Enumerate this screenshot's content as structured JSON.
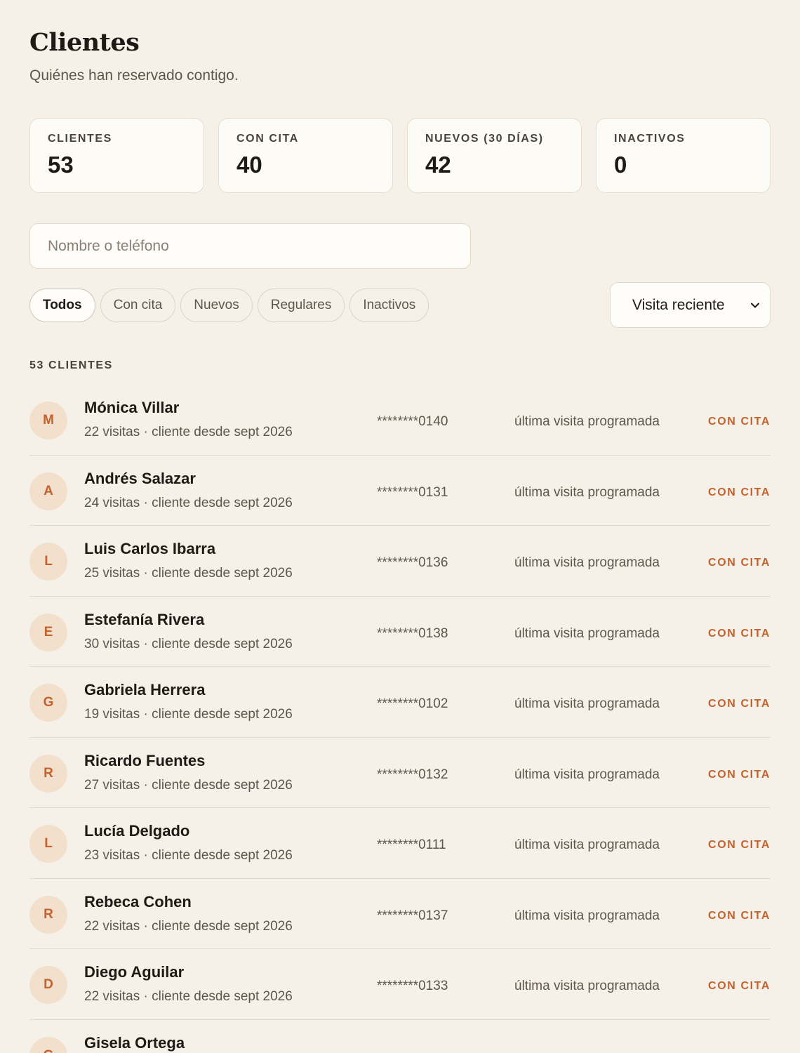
{
  "header": {
    "title": "Clientes",
    "subtitle": "Quiénes han reservado contigo."
  },
  "stats": [
    {
      "label": "CLIENTES",
      "value": "53"
    },
    {
      "label": "CON CITA",
      "value": "40"
    },
    {
      "label": "NUEVOS (30 DÍAS)",
      "value": "42"
    },
    {
      "label": "INACTIVOS",
      "value": "0"
    }
  ],
  "search": {
    "placeholder": "Nombre o teléfono",
    "value": ""
  },
  "filters": {
    "active": "Todos",
    "items": [
      "Todos",
      "Con cita",
      "Nuevos",
      "Regulares",
      "Inactivos"
    ]
  },
  "sort": {
    "selected": "Visita reciente"
  },
  "list": {
    "count_label": "53 CLIENTES",
    "clients": [
      {
        "initial": "M",
        "name": "Mónica Villar",
        "visits": "22 visitas",
        "since": "cliente desde sept 2026",
        "phone": "********0140",
        "last_visit": "última visita programada",
        "status": "CON CITA"
      },
      {
        "initial": "A",
        "name": "Andrés Salazar",
        "visits": "24 visitas",
        "since": "cliente desde sept 2026",
        "phone": "********0131",
        "last_visit": "última visita programada",
        "status": "CON CITA"
      },
      {
        "initial": "L",
        "name": "Luis Carlos Ibarra",
        "visits": "25 visitas",
        "since": "cliente desde sept 2026",
        "phone": "********0136",
        "last_visit": "última visita programada",
        "status": "CON CITA"
      },
      {
        "initial": "E",
        "name": "Estefanía Rivera",
        "visits": "30 visitas",
        "since": "cliente desde sept 2026",
        "phone": "********0138",
        "last_visit": "última visita programada",
        "status": "CON CITA"
      },
      {
        "initial": "G",
        "name": "Gabriela Herrera",
        "visits": "19 visitas",
        "since": "cliente desde sept 2026",
        "phone": "********0102",
        "last_visit": "última visita programada",
        "status": "CON CITA"
      },
      {
        "initial": "R",
        "name": "Ricardo Fuentes",
        "visits": "27 visitas",
        "since": "cliente desde sept 2026",
        "phone": "********0132",
        "last_visit": "última visita programada",
        "status": "CON CITA"
      },
      {
        "initial": "L",
        "name": "Lucía Delgado",
        "visits": "23 visitas",
        "since": "cliente desde sept 2026",
        "phone": "********0111",
        "last_visit": "última visita programada",
        "status": "CON CITA"
      },
      {
        "initial": "R",
        "name": "Rebeca Cohen",
        "visits": "22 visitas",
        "since": "cliente desde sept 2026",
        "phone": "********0137",
        "last_visit": "última visita programada",
        "status": "CON CITA"
      },
      {
        "initial": "D",
        "name": "Diego Aguilar",
        "visits": "22 visitas",
        "since": "cliente desde sept 2026",
        "phone": "********0133",
        "last_visit": "última visita programada",
        "status": "CON CITA"
      },
      {
        "initial": "G",
        "name": "Gisela Ortega",
        "visits": "",
        "since": "",
        "phone": "",
        "last_visit": "",
        "status": ""
      }
    ]
  },
  "colors": {
    "background": "#f6f1e8",
    "card": "#fdfbf6",
    "accent": "#c4622d",
    "avatar_bg": "#f3e0cc",
    "text": "#1f1a15",
    "muted": "#5e554b"
  }
}
